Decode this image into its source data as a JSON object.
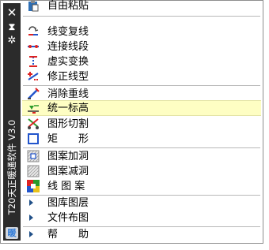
{
  "panel": {
    "title": "T20天正暖通软件 V3.0",
    "close_glyph": "✕",
    "pin_glyph": "⧗",
    "settings_glyph": "✲",
    "logo_glyph": "暖"
  },
  "menu": {
    "items": [
      {
        "label": "自由粘贴",
        "icon": "paste-icon"
      },
      {
        "label": "线变复线",
        "icon": "line-to-polyline-icon"
      },
      {
        "label": "连接线段",
        "icon": "connect-lines-icon"
      },
      {
        "label": "虚实变换",
        "icon": "dash-solid-icon"
      },
      {
        "label": "修正线型",
        "icon": "fix-linetype-icon"
      },
      {
        "label": "消除重线",
        "icon": "remove-overlap-icon"
      },
      {
        "label": "统一标高",
        "icon": "unify-elevation-icon",
        "highlighted": true
      },
      {
        "label": "图形切割",
        "icon": "cut-icon"
      },
      {
        "label": "矩　　形",
        "icon": "rectangle-icon"
      },
      {
        "label": "图案加洞",
        "icon": "hatch-add-hole-icon"
      },
      {
        "label": "图案减洞",
        "icon": "hatch-remove-hole-icon"
      },
      {
        "label": "线 图 案",
        "icon": "line-pattern-icon"
      },
      {
        "label": "图库图层",
        "icon": "chevron-right-icon"
      },
      {
        "label": "文件布图",
        "icon": "chevron-right-icon"
      },
      {
        "label": "帮　　助",
        "icon": "chevron-right-icon"
      }
    ]
  },
  "colors": {
    "title_bar": "#2b2b2b",
    "highlight": "#fefec3",
    "submenu_arrow": "#1f4f87",
    "separator": "#b8b8b8"
  }
}
